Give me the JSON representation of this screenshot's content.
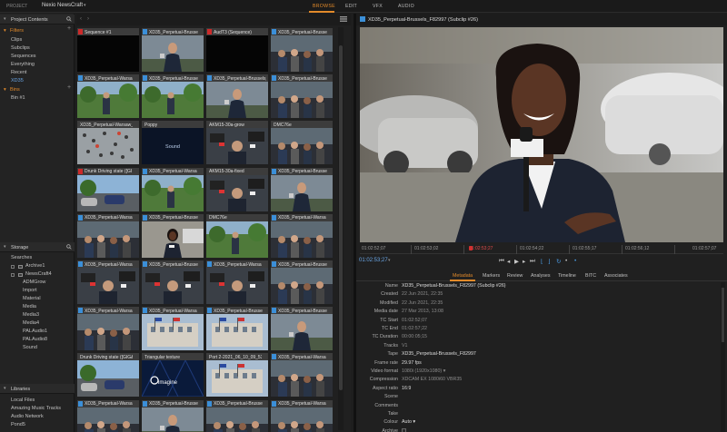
{
  "topbar": {
    "project_label": "PROJECT",
    "project_name": "Nexio NewsCraft",
    "tabs": [
      "BROWSE",
      "EDIT",
      "VFX",
      "AUDIO"
    ],
    "active_tab": "BROWSE"
  },
  "project_contents": {
    "title": "Project Contents",
    "filters_label": "Filters",
    "filters": [
      "Clips",
      "Subclips",
      "Sequences",
      "Everything",
      "Recent",
      "XD35"
    ],
    "selected_filter": "XD35",
    "bins_label": "Bins",
    "bins": [
      "Bin #1"
    ]
  },
  "storage": {
    "title": "Storage",
    "searches_label": "Searches",
    "items": [
      "Archive1",
      "NewsCraft4",
      "ADMGrow",
      "Import",
      "Material",
      "Media",
      "Media3",
      "Media4",
      "PALAudio1",
      "PALAudio8",
      "Sound"
    ]
  },
  "libraries": {
    "title": "Libraries",
    "items": [
      "Local Files",
      "Amazing Music Tracks",
      "Audio Network",
      "Pond5"
    ]
  },
  "grid": {
    "clips": [
      {
        "name": "Sequence #1",
        "mark": "red",
        "scene": "black"
      },
      {
        "name": "XD35_Perpetual-Brusse",
        "mark": "blue",
        "scene": "reporter-male"
      },
      {
        "name": "AudT3 (Sequence)",
        "mark": "red",
        "scene": "black"
      },
      {
        "name": "XD35_Perpetual-Brusse",
        "mark": "blue",
        "scene": "press-crowd"
      },
      {
        "name": "XD35_Perpetual-Warsa",
        "mark": "blue",
        "scene": "park-outdoor"
      },
      {
        "name": "XD35_Perpetual-Brusse",
        "mark": "blue",
        "scene": "park-outdoor"
      },
      {
        "name": "XD35_Perpetual-Brussels_F",
        "mark": "blue",
        "scene": "reporter-male"
      },
      {
        "name": "XD35_Perpetual-Brusse",
        "mark": "blue",
        "scene": "press-crowd"
      },
      {
        "name": "XD35_Perpetual-Warsaw_F",
        "mark": "none",
        "scene": "aerial-crowd"
      },
      {
        "name": "Poppy",
        "mark": "none",
        "scene": "sound"
      },
      {
        "name": "AKM15-30a-grow",
        "mark": "none",
        "scene": "press-scrum"
      },
      {
        "name": "DMC76e",
        "mark": "none",
        "scene": "press-crowd"
      },
      {
        "name": "Drunk Driving state ([GI",
        "mark": "red",
        "scene": "street-cars"
      },
      {
        "name": "XD35_Perpetual-Warsa",
        "mark": "blue",
        "scene": "park-outdoor"
      },
      {
        "name": "AKM15-30a-fixed",
        "mark": "none",
        "scene": "press-scrum"
      },
      {
        "name": "XD35_Perpetual-Brusse",
        "mark": "blue",
        "scene": "reporter-male"
      },
      {
        "name": "XD35_Perpetual-Warsa",
        "mark": "blue",
        "scene": "press-crowd"
      },
      {
        "name": "XD35_Perpetual-Brusse",
        "mark": "blue",
        "scene": "reporter-female"
      },
      {
        "name": "DMC76e",
        "mark": "none",
        "scene": "park-outdoor"
      },
      {
        "name": "XD35_Perpetual-Warsa",
        "mark": "blue",
        "scene": "press-crowd"
      },
      {
        "name": "XD35_Perpetual-Warsa",
        "mark": "blue",
        "scene": "press-scrum"
      },
      {
        "name": "XD35_Perpetual-Brusse",
        "mark": "blue",
        "scene": "press-scrum"
      },
      {
        "name": "XD35_Perpetual-Warsa",
        "mark": "blue",
        "scene": "press-scrum"
      },
      {
        "name": "XD35_Perpetual-Brusse",
        "mark": "blue",
        "scene": "press-crowd"
      },
      {
        "name": "XD35_Perpetual-Warsa",
        "mark": "blue",
        "scene": "press-crowd"
      },
      {
        "name": "XD35_Perpetual-Warsa",
        "mark": "blue",
        "scene": "building-flags"
      },
      {
        "name": "XD35_Perpetual-Brusse",
        "mark": "blue",
        "scene": "building-flags"
      },
      {
        "name": "XD35_Perpetual-Brusse",
        "mark": "blue",
        "scene": "reporter-male"
      },
      {
        "name": "Drunk Driving state ([GIG&",
        "mark": "none",
        "scene": "street-cars"
      },
      {
        "name": "Triangular texture",
        "mark": "none",
        "scene": "imagine"
      },
      {
        "name": "Port 2-2021_06_10_09_53",
        "mark": "none",
        "scene": "building-flags"
      },
      {
        "name": "XD35_Perpetual-Warsa",
        "mark": "blue",
        "scene": "press-crowd"
      },
      {
        "name": "XD35_Perpetual-Warsa",
        "mark": "blue",
        "scene": "press-crowd"
      },
      {
        "name": "XD35_Perpetual-Brusse",
        "mark": "blue",
        "scene": "reporter-male"
      },
      {
        "name": "XD35_Perpetual-Brusse",
        "mark": "blue",
        "scene": "press-crowd"
      },
      {
        "name": "XD35_Perpetual-Warsa",
        "mark": "blue",
        "scene": "press-crowd"
      }
    ],
    "sound_text": "Sound",
    "imagine_text": "imagine"
  },
  "viewer": {
    "title": "XD35_Perpetual-Brussels_F82997 (Subclip #26)",
    "timecodes": [
      "01:02:52;07",
      "01:02:53;02",
      "01:02:53;27",
      "01:02:54;22",
      "01:02:55;17",
      "01:02:56;12",
      "01:02:57;07"
    ],
    "current_timecode": "01:02:53;27"
  },
  "tabs": [
    "Metadata",
    "Markers",
    "Review",
    "Analyses",
    "Timeline",
    "BITC",
    "Associates"
  ],
  "active_tab": "Metadata",
  "metadata": [
    {
      "key": "Name",
      "value": "XD35_Perpetual-Brussels_F82997 (Subclip #26)"
    },
    {
      "key": "Created",
      "value": "22 Jun 2021, 22:35",
      "dim": true
    },
    {
      "key": "Modified",
      "value": "22 Jun 2021, 22:35",
      "dim": true
    },
    {
      "key": "Media date",
      "value": "27 Mar 2013, 13:08",
      "dim": true
    },
    {
      "key": "TC Start",
      "value": "01:02:52;07",
      "dim": true
    },
    {
      "key": "TC End",
      "value": "01:02:57;22",
      "dim": true
    },
    {
      "key": "TC Duration",
      "value": "00:00:05;15",
      "dim": true
    },
    {
      "key": "Tracks",
      "value": "V1",
      "dim": true
    },
    {
      "key": "Tape",
      "value": "XD35_Perpetual-Brussels_F82997"
    },
    {
      "key": "Frame rate",
      "value": "29.97 fps"
    },
    {
      "key": "Video format",
      "value": "1080i (1920x1080)  ▾",
      "dim": true
    },
    {
      "key": "Compression",
      "value": "XDCAM EX 1080i60 VBR35",
      "dim": true
    },
    {
      "key": "Aspect ratio",
      "value": "16:9"
    },
    {
      "key": "Scene",
      "value": ""
    },
    {
      "key": "Comments",
      "value": ""
    },
    {
      "key": "Take",
      "value": ""
    },
    {
      "key": "Colour",
      "value": "Auto  ▾"
    },
    {
      "key": "Archive",
      "value": "",
      "checkbox": true
    },
    {
      "key": "Conform",
      "value": "",
      "checkbox": true
    }
  ],
  "colors": {
    "accent": "#e28a2a",
    "blue": "#3b8fd8",
    "red": "#cc2a2a"
  }
}
